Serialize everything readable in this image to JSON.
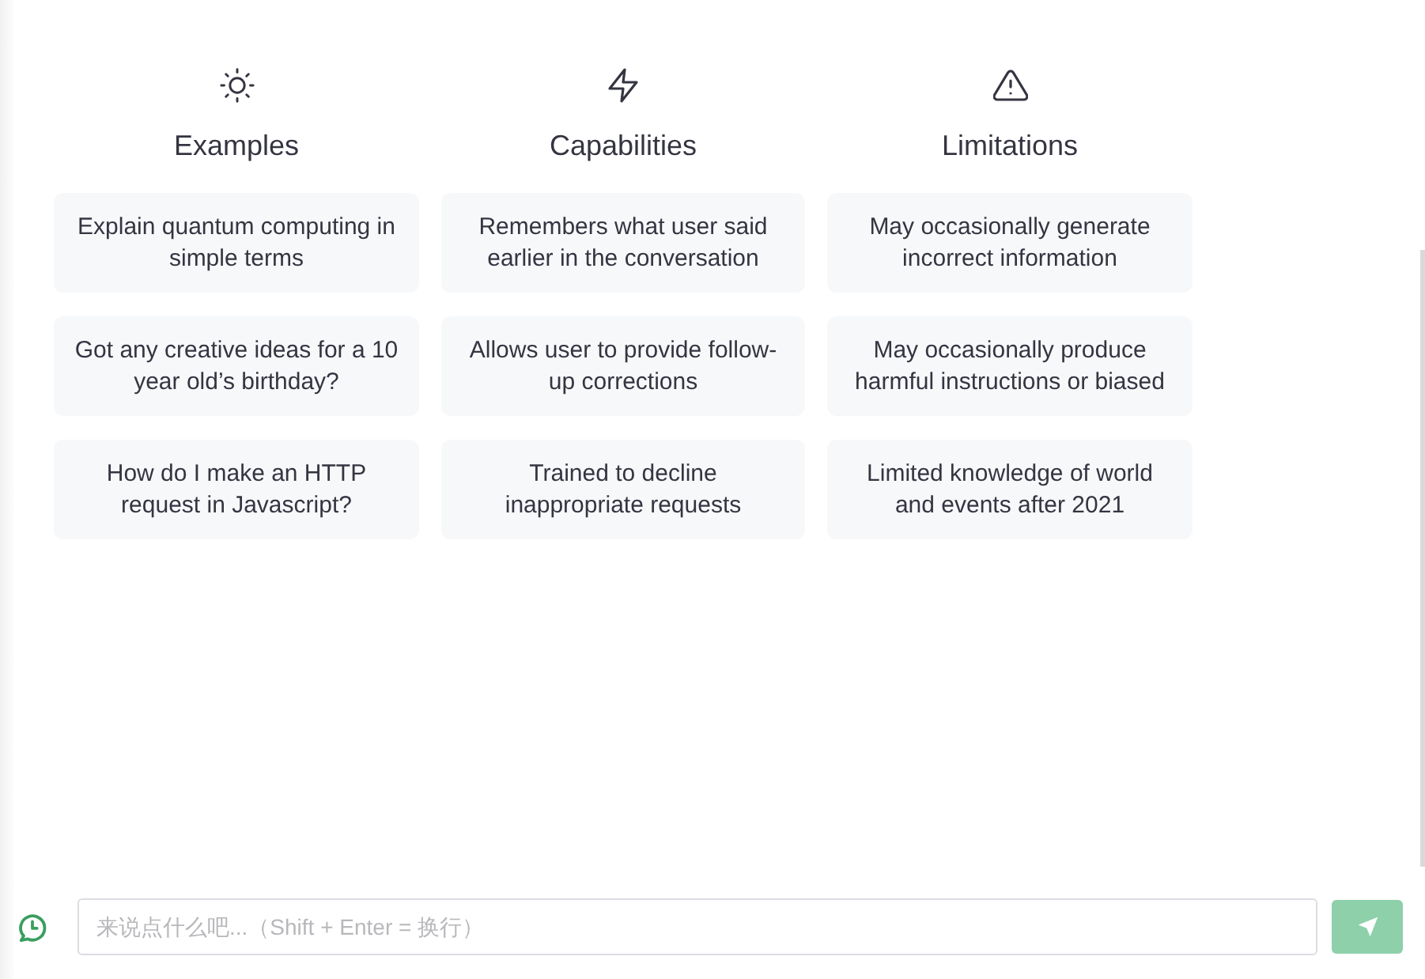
{
  "columns": [
    {
      "kind": "sun",
      "title": "Examples",
      "items": [
        "Explain quantum computing in simple terms",
        "Got any creative ideas for a 10 year old’s birthday?",
        "How do I make an HTTP request in Javascript?"
      ]
    },
    {
      "kind": "bolt",
      "title": "Capabilities",
      "items": [
        "Remembers what user said earlier in the conversation",
        "Allows user to provide follow-up corrections",
        "Trained to decline inappropriate requests"
      ]
    },
    {
      "kind": "warning",
      "title": "Limitations",
      "items": [
        "May occasionally generate incorrect information",
        "May occasionally produce harmful instructions or biased",
        "Limited knowledge of world and events after 2021"
      ]
    }
  ],
  "composer": {
    "placeholder": "来说点什么吧...（Shift + Enter = 换行）",
    "send_disabled": true
  }
}
